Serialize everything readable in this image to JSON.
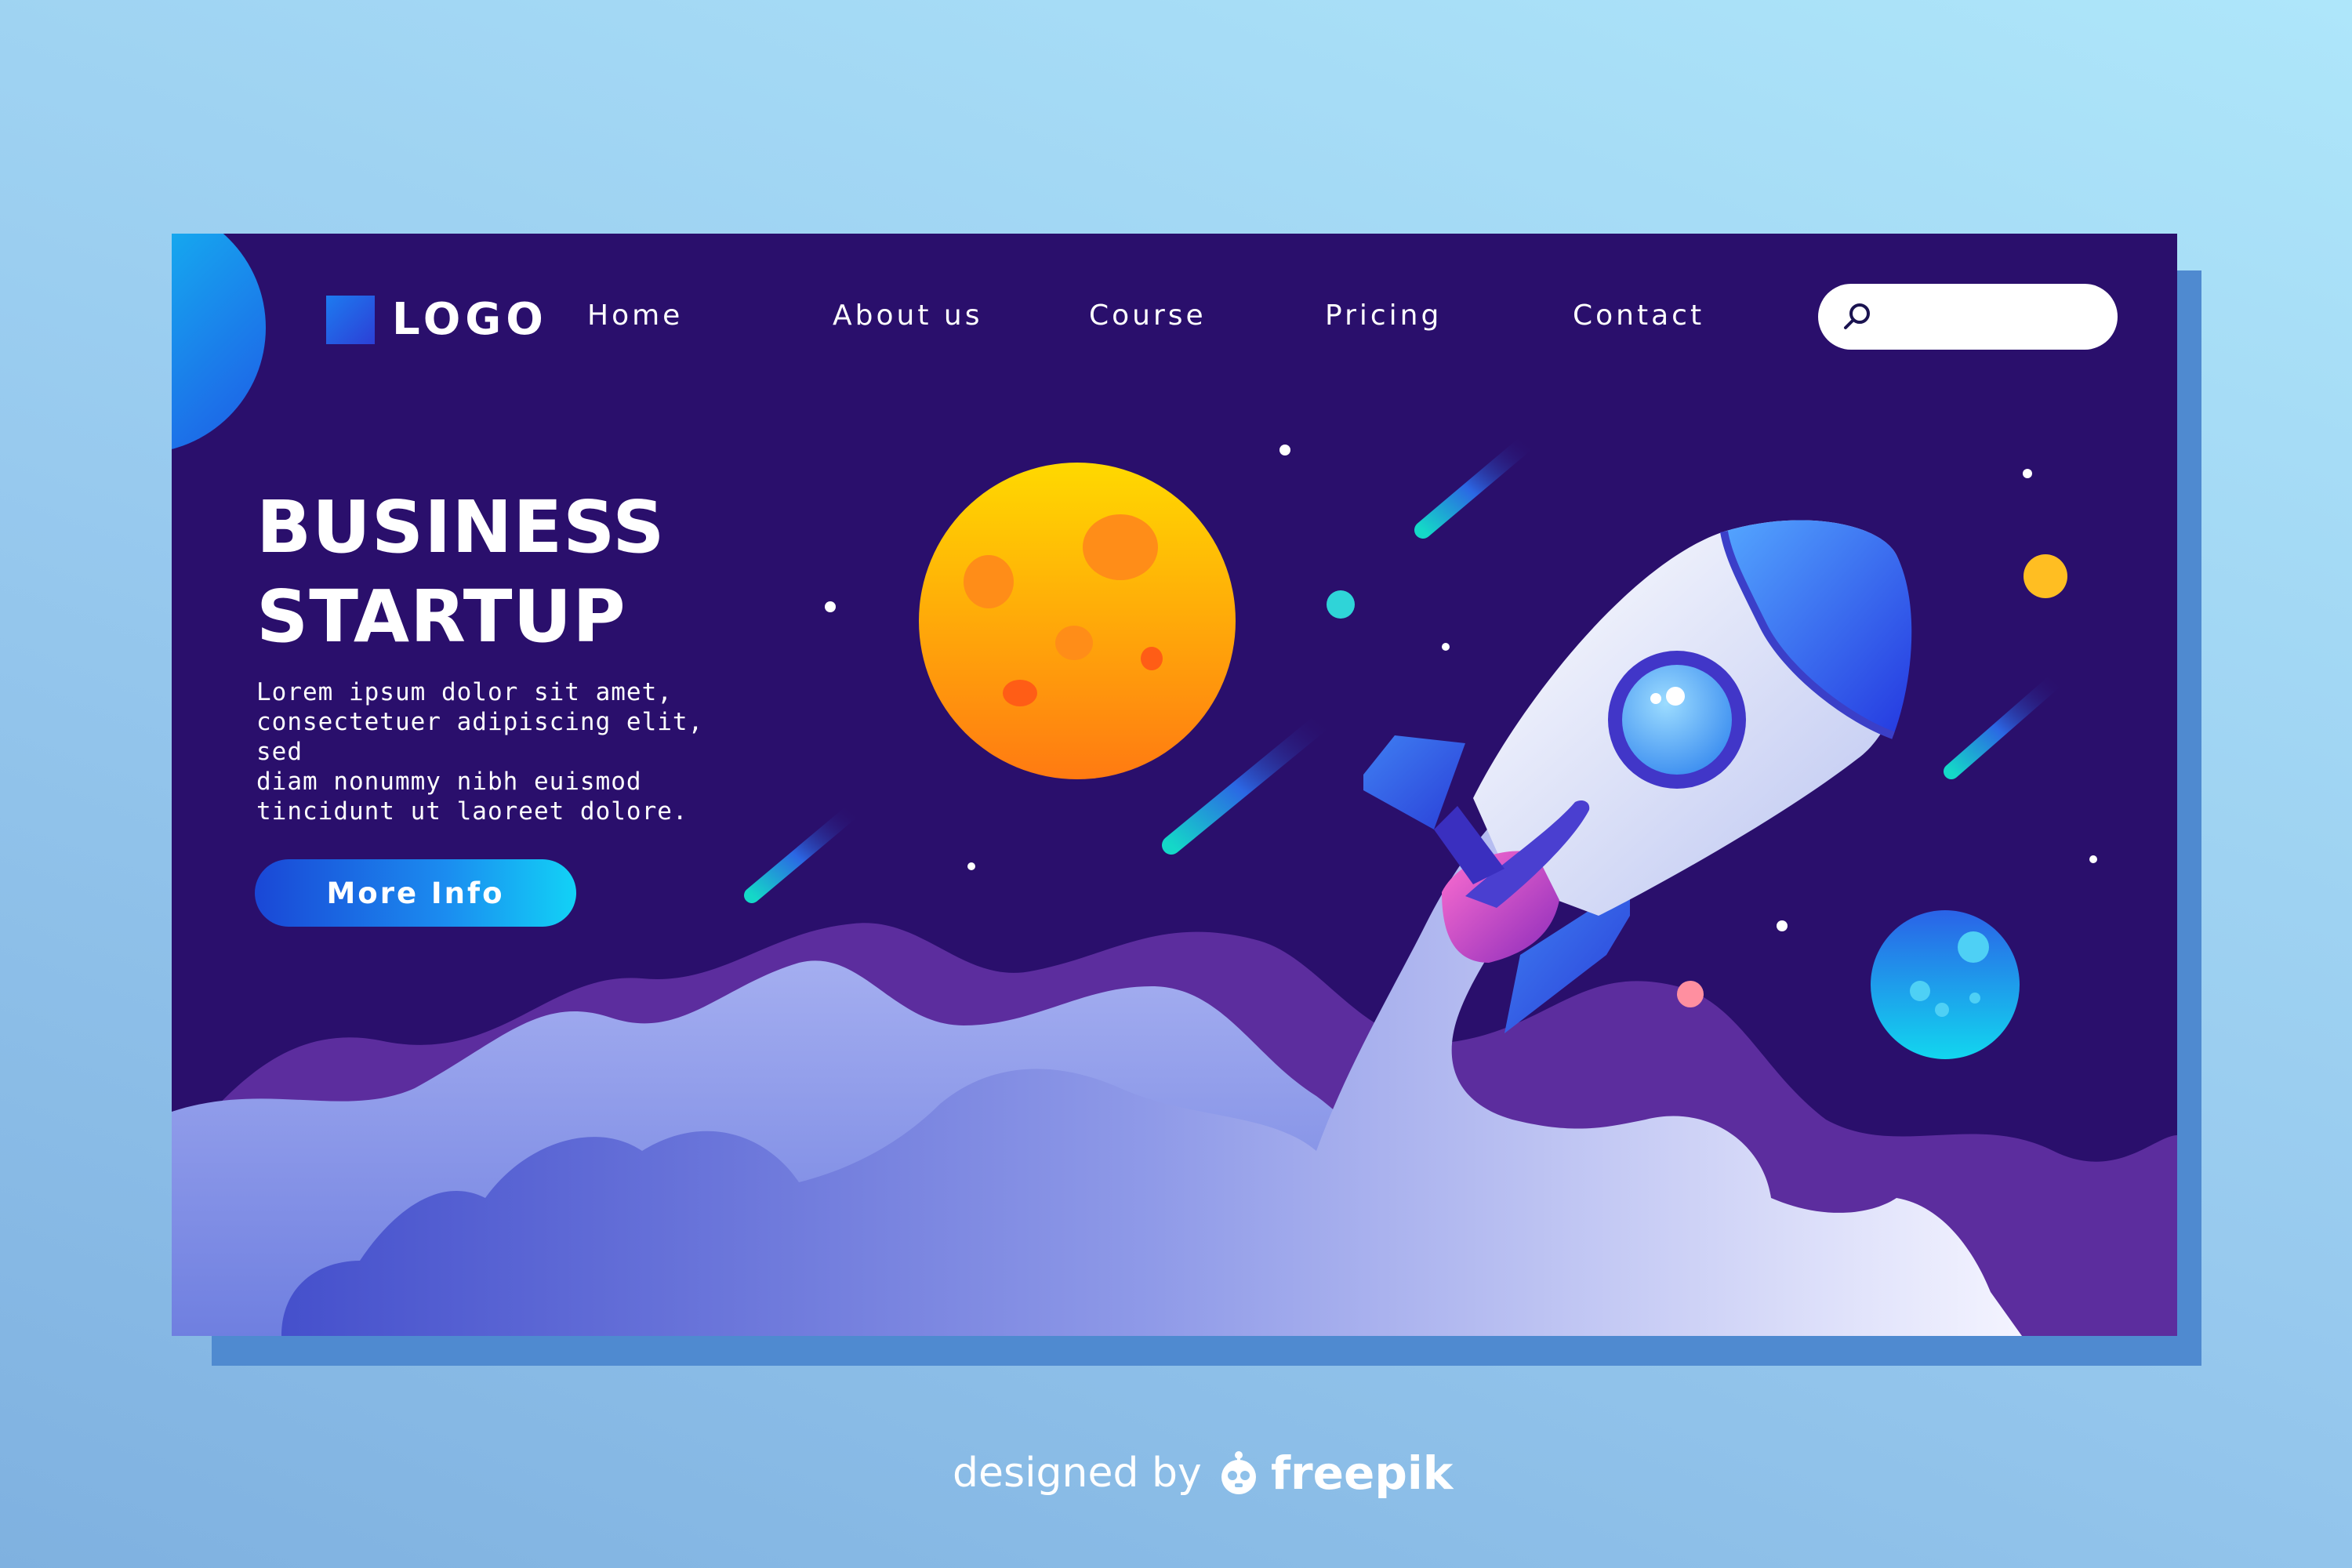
{
  "brand": {
    "logo_text": "LOGO"
  },
  "nav": {
    "items": [
      {
        "label": "Home"
      },
      {
        "label": "About us"
      },
      {
        "label": "Course"
      },
      {
        "label": "Pricing"
      },
      {
        "label": "Contact"
      }
    ]
  },
  "search": {
    "value": "",
    "icon": "search-icon"
  },
  "hero": {
    "title_line1": "BUSINESS",
    "title_line2": "STARTUP",
    "body_lines": [
      "Lorem ipsum dolor sit amet,",
      "consectetuer adipiscing elit, sed",
      "diam nonummy nibh euismod",
      "tincidunt ut laoreet dolore."
    ],
    "cta_label": "More Info"
  },
  "credit": {
    "designed_by": "designed by",
    "brand": "freepik"
  },
  "colors": {
    "page_background": "#97c9ee",
    "card_background": "#2a0f6c",
    "card_shadow": "#4f8ad0",
    "cta_start": "#1a47d6",
    "cta_end": "#12d2f6",
    "planet_orange": "#ffa31f",
    "planet_blue": "#1ea6f4",
    "cloud_purple": "#5c2d9e",
    "rocket_nose": "#2f55e6"
  }
}
